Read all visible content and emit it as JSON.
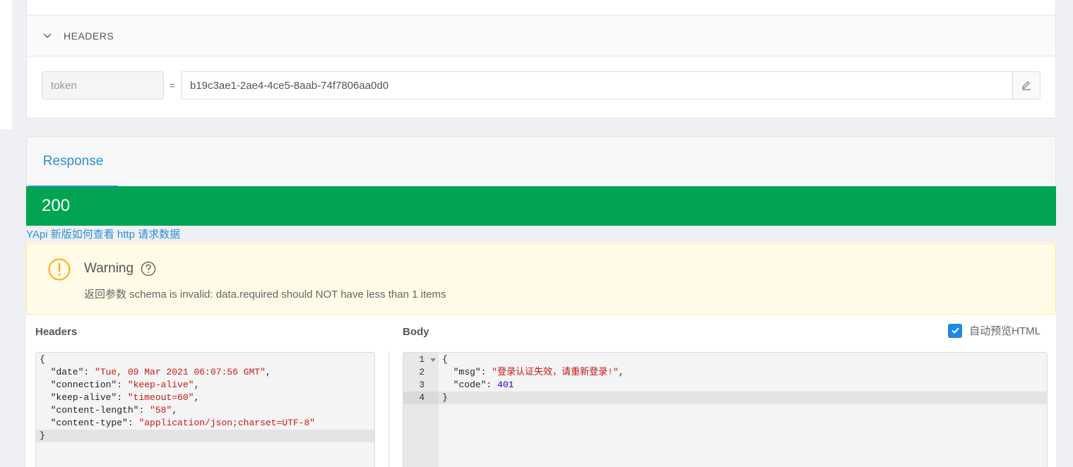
{
  "headers_section": {
    "title": "HEADERS",
    "key": "token",
    "equals": "=",
    "value": "b19c3ae1-2ae4-4ce5-8aab-74f7806aa0d0"
  },
  "response": {
    "tab_label": "Response",
    "status_code": "200",
    "help_link": "YApi 新版如何查看 http 请求数据",
    "warning": {
      "title": "Warning",
      "message": "返回参数 schema is invalid: data.required should NOT have less than 1 items"
    },
    "headers_label": "Headers",
    "body_label": "Body",
    "preview_label": "自动预览HTML",
    "preview_checked": true,
    "headers_json": [
      {
        "text": "{"
      },
      {
        "key": "\"date\"",
        "value": "\"Tue, 09 Mar 2021 06:07:56 GMT\"",
        "tail": ","
      },
      {
        "key": "\"connection\"",
        "value": "\"keep-alive\"",
        "tail": ","
      },
      {
        "key": "\"keep-alive\"",
        "value": "\"timeout=60\"",
        "tail": ","
      },
      {
        "key": "\"content-length\"",
        "value": "\"58\"",
        "tail": ","
      },
      {
        "key": "\"content-type\"",
        "value": "\"application/json;charset=UTF-8\"",
        "tail": ""
      },
      {
        "text": "}"
      }
    ],
    "body_json": [
      {
        "text": "{"
      },
      {
        "key": "\"msg\"",
        "value": "\"登录认证失效，请重新登录!\"",
        "tail": ","
      },
      {
        "key": "\"code\"",
        "num": "401",
        "tail": ""
      },
      {
        "text": "}"
      }
    ],
    "body_line_numbers": [
      "1",
      "2",
      "3",
      "4"
    ]
  },
  "colors": {
    "status_success": "#01a452",
    "accent": "#2f8fd8",
    "warning_bg": "#fffbe6",
    "warning_icon": "#faad14"
  }
}
